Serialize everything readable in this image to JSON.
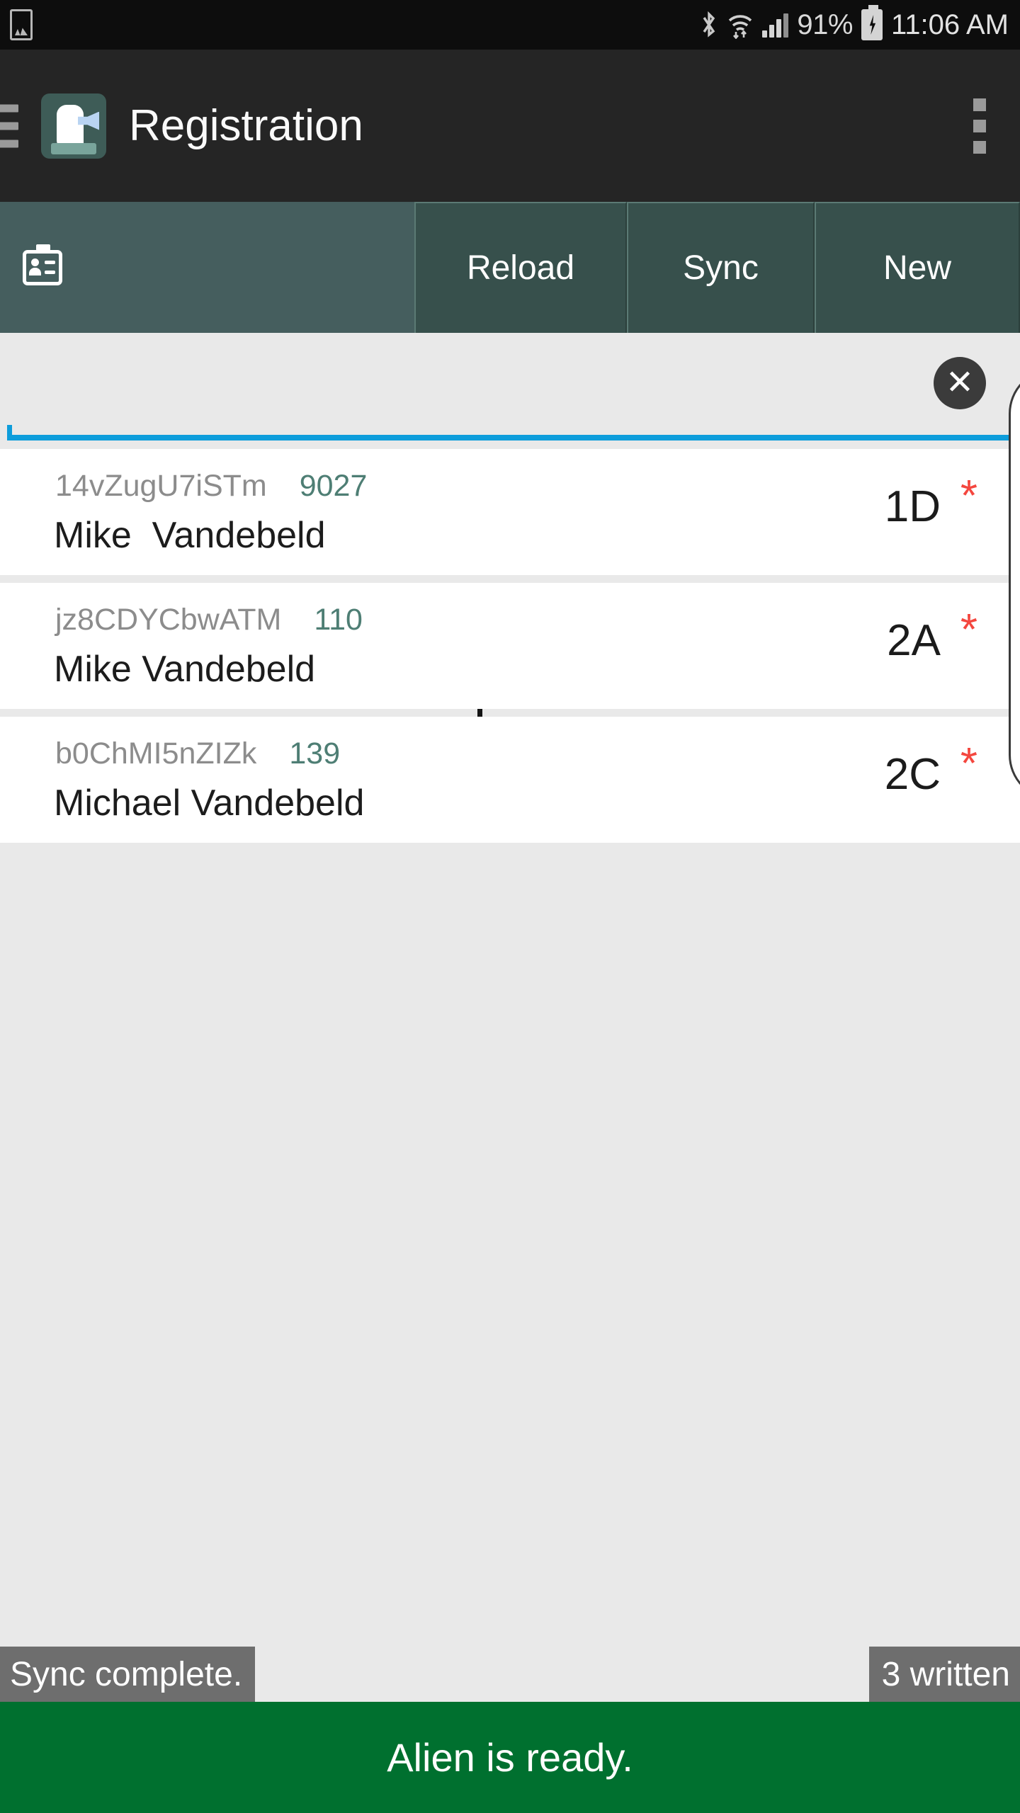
{
  "status_bar": {
    "left_icon": "photo-icon",
    "bluetooth_icon": "bluetooth-icon",
    "wifi_icon": "wifi-icon",
    "signal_icon": "signal-bars-icon",
    "battery_percent": "91%",
    "battery_icon": "battery-charging-icon",
    "time": "11:06 AM"
  },
  "app_bar": {
    "menu_icon": "hamburger-menu-icon",
    "app_icon": "registration-app-icon",
    "title": "Registration",
    "overflow_icon": "overflow-menu-icon"
  },
  "toolbar": {
    "badge_icon": "id-badge-icon",
    "reload_label": "Reload",
    "sync_label": "Sync",
    "new_label": "New",
    "bg_color": "#455e5e",
    "button_color": "#37504c"
  },
  "search": {
    "value": "",
    "placeholder": "",
    "clear_icon": "clear-x-icon",
    "clear_glyph": "✕",
    "underline_color": "#0d9ddb"
  },
  "list": {
    "rows": [
      {
        "id": "14vZugU7iSTm",
        "number": "9027",
        "name": "Mike  Vandebeld",
        "code": "1D",
        "flag": "*"
      },
      {
        "id": "jz8CDYCbwATM",
        "number": "110",
        "name": "Mike Vandebeld",
        "code": "2A",
        "flag": "*"
      },
      {
        "id": "b0ChMI5nZIZk",
        "number": "139",
        "name": "Michael Vandebeld",
        "code": "2C",
        "flag": "*"
      }
    ],
    "id_color": "#8c8c8c",
    "number_color": "#4e7e74",
    "flag_color": "#f4473f"
  },
  "bottom": {
    "toast_left": "Sync complete.",
    "toast_right": "3 written",
    "banner": "Alien is ready.",
    "banner_color": "#00702f",
    "toast_color": "#6e6e6e"
  }
}
